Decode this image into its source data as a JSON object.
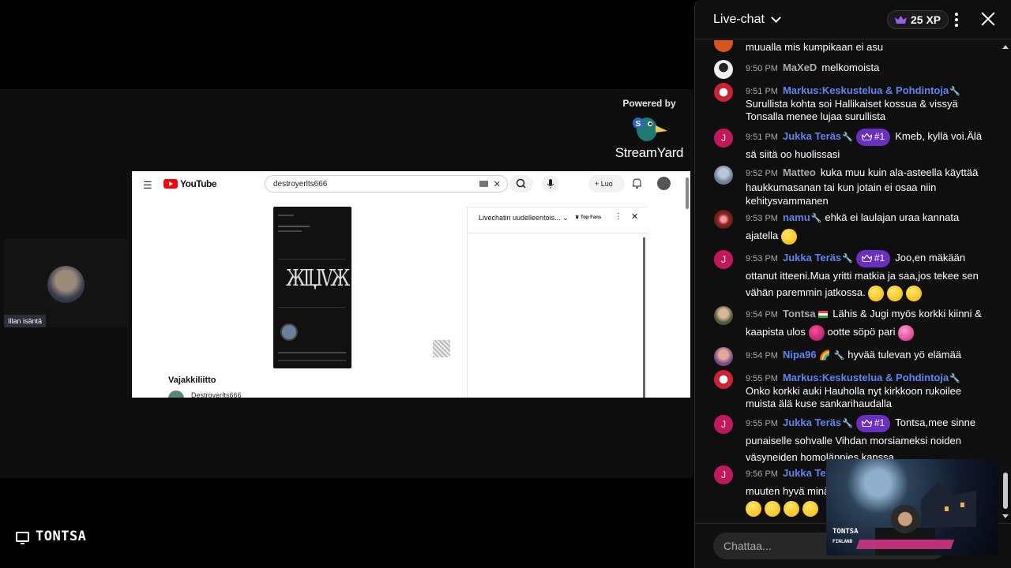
{
  "stream": {
    "powered_by": "Powered by",
    "brand": "StreamYard",
    "presenter_name": "Illan isäntä",
    "screen_share_label": "TONTSA"
  },
  "shared_screen": {
    "search_query": "destroyerlts666",
    "create_label": "Luo",
    "video_title": "Vajakkiliitto",
    "channel_name": "DestroyerIts666",
    "livechat_header": "Livechatin uudelleentois...",
    "top_fans": "Top Fans",
    "logo_word": "YouTube"
  },
  "chat": {
    "title": "Live-chat",
    "xp": "25 XP",
    "input_placeholder": "Chattaa...",
    "accent": "#6a2fc0",
    "mod_color": "#5e84f1",
    "messages": [
      {
        "time": "",
        "author": "",
        "text": "muualla mis kumpikaan ei asu"
      },
      {
        "time": "9:50 PM",
        "author": "MaXeD",
        "text": "melkomoista"
      },
      {
        "time": "9:51 PM",
        "author": "Markus:Keskustelua & Pohdintoja",
        "text": "Surullista kohta soi Hallikaiset kossua & vissyä Tonsalla menee lujaa surullista"
      },
      {
        "time": "9:51 PM",
        "author": "Jukka Teräs",
        "badge": "#1",
        "text": "Kmeb, kyllä voi.Älä sä siitä oo huolissasi"
      },
      {
        "time": "9:52 PM",
        "author": "Matteo",
        "text": "kuka muu kuin ala-asteella käyttää haukkumasanan tai kun jotain ei osaa niin kehitysvammanen"
      },
      {
        "time": "9:53 PM",
        "author": "namu",
        "text": "ehkä ei laulajan uraa kannata ajatella"
      },
      {
        "time": "9:53 PM",
        "author": "Jukka Teräs",
        "badge": "#1",
        "text": "Joo,en mäkään ottanut itteeni.Mua yritti matkia ja saa,jos tekee sen vähän paremmin jatkossa."
      },
      {
        "time": "9:54 PM",
        "author": "Tontsa",
        "text": "Lähis & Jugi myös korkki kiinni & kaapista ulos",
        "text2": "ootte söpö pari"
      },
      {
        "time": "9:54 PM",
        "author": "Nipa96",
        "text": "hyvää tulevan yö elämää"
      },
      {
        "time": "9:55 PM",
        "author": "Markus:Keskustelua & Pohdintoja",
        "text": "Onko korkki auki Hauholla nyt kirkkoon rukoilee muista älä kuse sankarihaudalla"
      },
      {
        "time": "9:55 PM",
        "author": "Jukka Teräs",
        "badge": "#1",
        "text": "Tontsa,mee sinne punaiselle sohvalle Vihdan morsiameksi noiden väsyneiden homoläppies kanssa."
      },
      {
        "time": "9:56 PM",
        "author": "Jukka Ter",
        "text": "muuten hyvä minä"
      }
    ],
    "avatar_letter": "J"
  },
  "overlay_cam": {
    "name": "TONTSA",
    "country": "FINLAND"
  }
}
